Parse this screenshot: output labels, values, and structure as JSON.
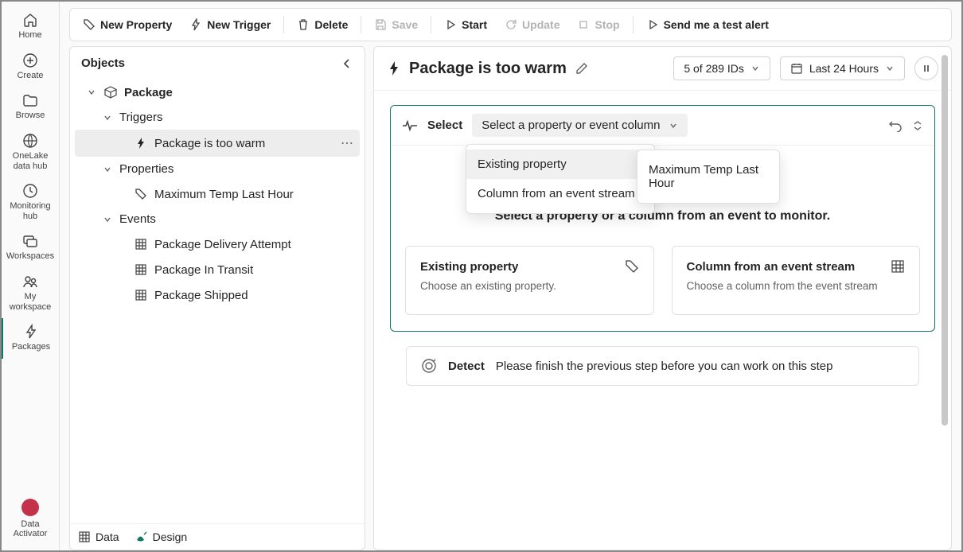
{
  "rail": {
    "home": "Home",
    "create": "Create",
    "browse": "Browse",
    "onelake": "OneLake data hub",
    "monitoring": "Monitoring hub",
    "workspaces": "Workspaces",
    "myworkspace": "My workspace",
    "packages": "Packages",
    "activator": "Data Activator"
  },
  "toolbar": {
    "new_property": "New Property",
    "new_trigger": "New Trigger",
    "delete": "Delete",
    "save": "Save",
    "start": "Start",
    "update": "Update",
    "stop": "Stop",
    "send_test": "Send me a test alert"
  },
  "objects": {
    "title": "Objects",
    "package": "Package",
    "triggers": "Triggers",
    "trigger1": "Package is too warm",
    "properties": "Properties",
    "prop1": "Maximum Temp Last Hour",
    "events": "Events",
    "ev1": "Package Delivery Attempt",
    "ev2": "Package In Transit",
    "ev3": "Package Shipped",
    "tab_data": "Data",
    "tab_design": "Design"
  },
  "canvas": {
    "title": "Package is too warm",
    "ids_label": "5 of 289 IDs",
    "time_label": "Last 24 Hours"
  },
  "select": {
    "label": "Select",
    "dropdown": "Select a property or event column",
    "menu_existing": "Existing property",
    "menu_column": "Column from an event stream",
    "sub_item": "Maximum Temp Last Hour",
    "monitor_text": "Select a property or a column from an event to monitor.",
    "card1_title": "Existing property",
    "card1_desc": "Choose an existing property.",
    "card2_title": "Column from an event stream",
    "card2_desc": "Choose a column from the event stream"
  },
  "detect": {
    "label": "Detect",
    "text": "Please finish the previous step before you can work on this step"
  }
}
